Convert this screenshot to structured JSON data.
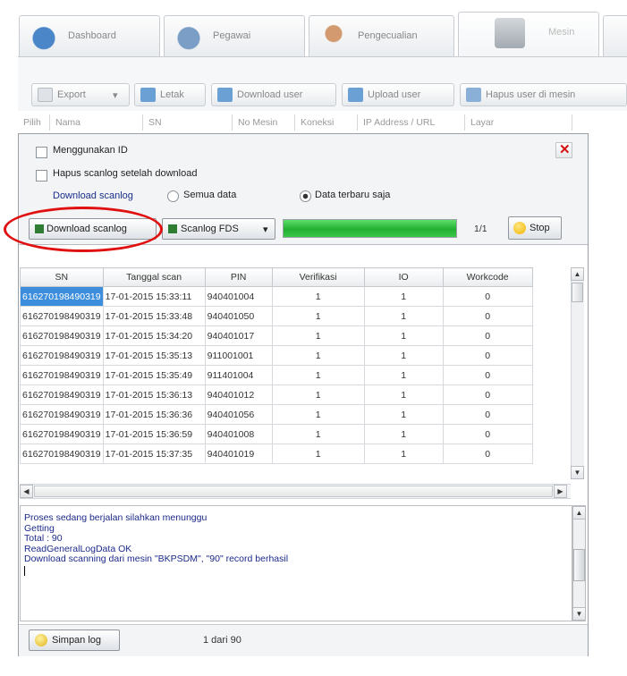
{
  "tabs": [
    {
      "label": "Dashboard",
      "color": "#4a86c8"
    },
    {
      "label": "Pegawai",
      "color": "#7a9ec6"
    },
    {
      "label": "Pengecualian",
      "color": "#d29a6e"
    },
    {
      "label": "Mesin",
      "color": "#9aa3ab"
    }
  ],
  "toolbar": {
    "export": "Export",
    "letak": "Letak",
    "download_user": "Download user",
    "upload_user": "Upload user",
    "hapus_user": "Hapus user di mesin"
  },
  "machine_columns": [
    "Pilih",
    "Nama",
    "SN",
    "No Mesin",
    "Koneksi",
    "IP Address / URL",
    "Layar"
  ],
  "panel": {
    "use_id": "Menggunakan ID",
    "delete_after": "Hapus scanlog setelah download",
    "download_label": "Download scanlog",
    "radio_all": "Semua data",
    "radio_new": "Data terbaru saja",
    "btn_download": "Download scanlog",
    "btn_scanlog_fds": "Scanlog FDS",
    "progress_value": 1.0,
    "progress_text": "1/1",
    "btn_stop": "Stop"
  },
  "grid": {
    "headers": [
      "SN",
      "Tanggal scan",
      "PIN",
      "Verifikasi",
      "IO",
      "Workcode"
    ],
    "rows": [
      [
        "616270198490319",
        "17-01-2015 15:33:11",
        "940401004",
        "1",
        "1",
        "0"
      ],
      [
        "616270198490319",
        "17-01-2015 15:33:48",
        "940401050",
        "1",
        "1",
        "0"
      ],
      [
        "616270198490319",
        "17-01-2015 15:34:20",
        "940401017",
        "1",
        "1",
        "0"
      ],
      [
        "616270198490319",
        "17-01-2015 15:35:13",
        "911001001",
        "1",
        "1",
        "0"
      ],
      [
        "616270198490319",
        "17-01-2015 15:35:49",
        "911401004",
        "1",
        "1",
        "0"
      ],
      [
        "616270198490319",
        "17-01-2015 15:36:13",
        "940401012",
        "1",
        "1",
        "0"
      ],
      [
        "616270198490319",
        "17-01-2015 15:36:36",
        "940401056",
        "1",
        "1",
        "0"
      ],
      [
        "616270198490319",
        "17-01-2015 15:36:59",
        "940401008",
        "1",
        "1",
        "0"
      ],
      [
        "616270198490319",
        "17-01-2015 15:37:35",
        "940401019",
        "1",
        "1",
        "0"
      ]
    ]
  },
  "log": [
    "Proses sedang berjalan silahkan menunggu",
    "Getting",
    "Total : 90",
    "ReadGeneralLogData OK",
    "Download scanning dari mesin \"BKPSDM\", \"90\" record berhasil"
  ],
  "footer": {
    "save_log": "Simpan log",
    "page_info": "1 dari 90"
  },
  "colors": {
    "selection": "#3c8edc",
    "progress": "#2fc040",
    "annotation": "#e01010",
    "log_text": "#1c2a8a"
  }
}
